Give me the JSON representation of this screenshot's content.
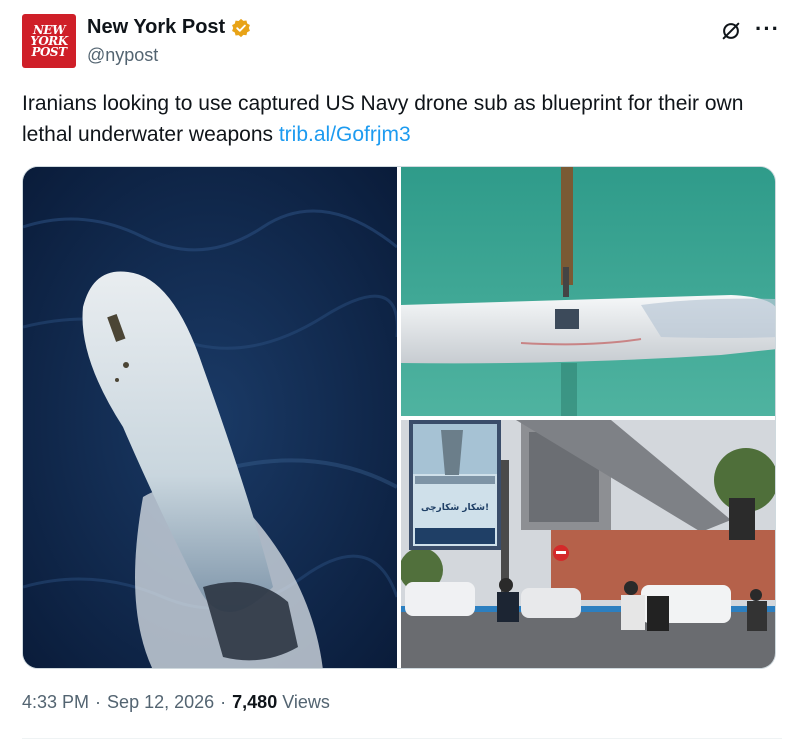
{
  "author": {
    "display_name": "New York Post",
    "handle": "@nypost",
    "avatar_lines": [
      "NEW",
      "YORK",
      "POST"
    ],
    "verified_color": "#e8a317"
  },
  "tweet": {
    "text": "Iranians looking to use captured US Navy drone sub as blueprint for their own lethal underwater weapons ",
    "link": "trib.al/Gofrjm3"
  },
  "media": {
    "billboard_text": "شکار شکارچی!",
    "images": [
      {
        "icon": "aerial-drone-sub-photo"
      },
      {
        "icon": "crane-lifting-sub-photo"
      },
      {
        "icon": "tehran-street-billboard-photo"
      }
    ]
  },
  "meta": {
    "time": "4:33 PM",
    "separator": "·",
    "date": "Sep 12, 2026",
    "views_count": "7,480",
    "views_label": "Views"
  },
  "icons": {
    "grok": "grok-icon",
    "more": "more-icon"
  },
  "colors": {
    "link": "#1d9bf0",
    "secondary_text": "#536471",
    "brand_red": "#cf1f28"
  }
}
